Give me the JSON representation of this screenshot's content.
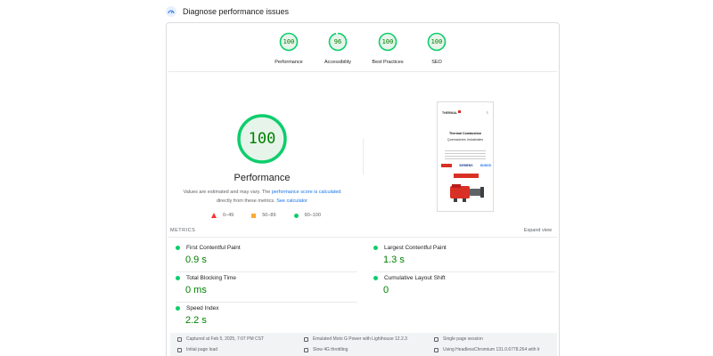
{
  "header": {
    "title": "Diagnose performance issues",
    "icon": "performance-gauge-icon"
  },
  "category_gauges": [
    {
      "score": "100",
      "label": "Performance",
      "score_value": 100
    },
    {
      "score": "96",
      "label": "Accessibility",
      "score_value": 96
    },
    {
      "score": "100",
      "label": "Best Practices",
      "score_value": 100
    },
    {
      "score": "100",
      "label": "SEO",
      "score_value": 100
    }
  ],
  "main_gauge": {
    "score": "100",
    "score_value": 100,
    "title": "Performance",
    "desc_prefix": "Values are estimated and may vary. The",
    "desc_link1": "performance score is calculated",
    "desc_middle": "directly from these metrics.",
    "desc_link2": "See calculator"
  },
  "legend": [
    {
      "shape": "triangle",
      "range": "0–49",
      "color": "#ff3333"
    },
    {
      "shape": "square",
      "range": "50–89",
      "color": "#ffaa33"
    },
    {
      "shape": "circle",
      "range": "90–100",
      "color": "#0cce6b"
    }
  ],
  "screenshot": {
    "logo": "THERMAL",
    "heading": "Thermal Combustion",
    "subheading": "Quemadores Industriales",
    "brand2": "SIEMENS",
    "brand3": "DUNGS"
  },
  "metrics": {
    "section_label": "METRICS",
    "expand_label": "Expand view",
    "items": [
      {
        "name": "First Contentful Paint",
        "value": "0.9 s"
      },
      {
        "name": "Largest Contentful Paint",
        "value": "1.3 s"
      },
      {
        "name": "Total Blocking Time",
        "value": "0 ms"
      },
      {
        "name": "Cumulative Layout Shift",
        "value": "0"
      },
      {
        "name": "Speed Index",
        "value": "2.2 s"
      }
    ]
  },
  "footer": {
    "captured": "Captured at Feb 5, 2025, 7:07 PM CST",
    "device": "Emulated Moto G Power with Lighthouse 12.2.3",
    "session": "Single page session",
    "initial": "Initial page load",
    "throttle": "Slow 4G throttling",
    "browser": "Using HeadlessChromium 131.0.6778.264 with lr"
  },
  "colors": {
    "pass": "#0cce6b",
    "pass_text": "#008000",
    "link": "#1a73e8"
  }
}
